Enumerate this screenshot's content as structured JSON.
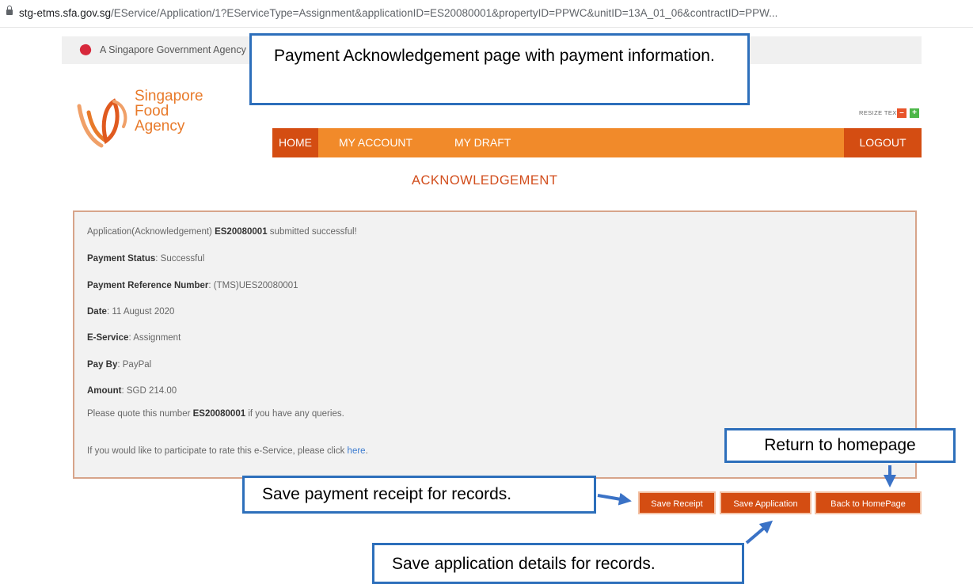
{
  "browser": {
    "url_host": "stg-etms.sfa.gov.sg",
    "url_path": "/EService/Application/1?EServiceType=Assignment&applicationID=ES20080001&propertyID=PPWC&unitID=13A_01_06&contractID=PPW..."
  },
  "govbar": {
    "text": "A Singapore Government Agency"
  },
  "logo": {
    "line1": "Singapore",
    "line2": "Food",
    "line3": "Agency"
  },
  "resize": {
    "label": "RESIZE TEXT",
    "minus": "–",
    "plus": "+"
  },
  "nav": {
    "home": "HOME",
    "account": "MY ACCOUNT",
    "draft": "MY DRAFT",
    "logout": "LOGOUT"
  },
  "page_title": "ACKNOWLEDGEMENT",
  "ack": {
    "intro_prefix": "Application(Acknowledgement) ",
    "app_id": "ES20080001",
    "intro_suffix": " submitted successful!",
    "status_label": "Payment Status",
    "status_value": ": Successful",
    "ref_label": "Payment Reference Number",
    "ref_value": ": (TMS)UES20080001",
    "date_label": "Date",
    "date_value": ": 11 August 2020",
    "service_label": "E-Service",
    "service_value": ": Assignment",
    "payby_label": "Pay By",
    "payby_value": ": PayPal",
    "amount_label": "Amount",
    "amount_value": ": SGD 214.00",
    "quote_prefix": "Please quote this number ",
    "quote_id": "ES20080001",
    "quote_suffix": " if you have any queries.",
    "rate_prefix": "If you would like to participate to rate this e-Service, please click ",
    "rate_link": "here",
    "rate_suffix": "."
  },
  "buttons": {
    "receipt": "Save Receipt",
    "application": "Save Application",
    "home": "Back to HomePage"
  },
  "callouts": {
    "top": "Payment Acknowledgement page with payment information.",
    "home": "Return to homepage",
    "receipt": "Save payment receipt for records.",
    "application": "Save application details for records."
  },
  "colors": {
    "nav_orange": "#f18a2a",
    "nav_dark": "#d44d12",
    "callout_border": "#2d6fbb",
    "title": "#d24d1c"
  }
}
